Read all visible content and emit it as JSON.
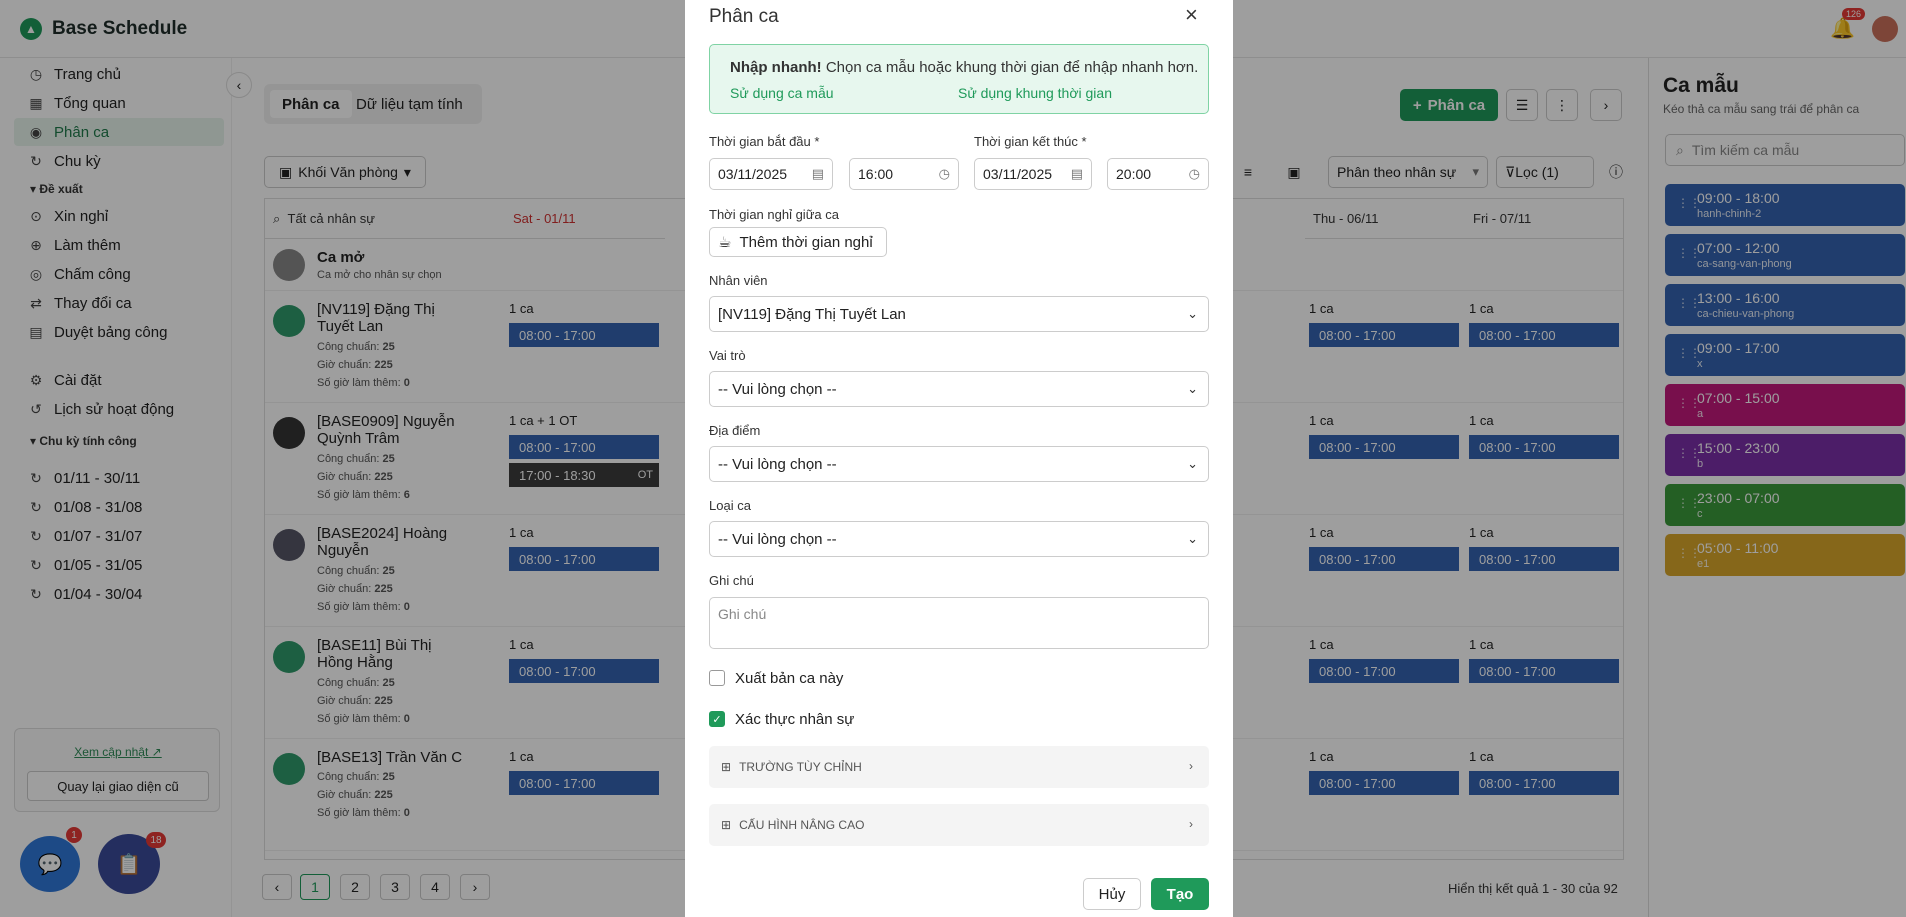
{
  "app": {
    "title": "Base Schedule",
    "notif_count": "126"
  },
  "sidebar": {
    "items": [
      {
        "label": "Trang chủ",
        "icon": "clock-icon"
      },
      {
        "label": "Tổng quan",
        "icon": "grid-icon"
      },
      {
        "label": "Phân ca",
        "icon": "shift-icon"
      },
      {
        "label": "Chu kỳ",
        "icon": "cycle-icon"
      }
    ],
    "section_propose": "Đề xuất",
    "propose_items": [
      {
        "label": "Xin nghỉ"
      },
      {
        "label": "Làm thêm"
      },
      {
        "label": "Chấm công"
      },
      {
        "label": "Thay đổi ca"
      },
      {
        "label": "Duyệt bảng công"
      }
    ],
    "settings_items": [
      {
        "label": "Cài đặt"
      },
      {
        "label": "Lịch sử hoạt động"
      }
    ],
    "section_cycles": "Chu kỳ tính công",
    "cycles": [
      "01/11 - 30/11",
      "01/08 - 31/08",
      "01/07 - 31/07",
      "01/05 - 31/05",
      "01/04 - 30/04"
    ],
    "update_link": "Xem cập nhật",
    "back_button": "Quay lại giao diện cũ",
    "fab1_badge": "1",
    "fab2_badge": "18"
  },
  "main": {
    "tabs": [
      "Phân ca",
      "Dữ liệu tạm tính"
    ],
    "add_button": "Phân ca",
    "office_filter": "Khối Văn phòng",
    "group_by": "Phân theo nhân sự",
    "filter_label": "Lọc (1)",
    "grid_headers": {
      "all_staff": "Tất cả nhân sự",
      "sat": "Sat - 01/11",
      "thu": "Thu - 06/11",
      "fri": "Fri - 07/11"
    },
    "open_shift": {
      "title": "Ca mở",
      "subtitle": "Ca mở cho nhân sự chọn"
    },
    "employees": [
      {
        "name": "[NV119] Đặng Thị Tuyết Lan",
        "cong_label": "Công chuẩn:",
        "cong": "25",
        "gio_label": "Giờ chuẩn:",
        "gio": "225",
        "ot_label": "Số giờ làm thêm:",
        "ot": "0",
        "count": "1 ca",
        "shift": "08:00 - 17:00"
      },
      {
        "name": "[BASE0909] Nguyễn Quỳnh Trâm",
        "cong_label": "Công chuẩn:",
        "cong": "25",
        "gio_label": "Giờ chuẩn:",
        "gio": "225",
        "ot_label": "Số giờ làm thêm:",
        "ot": "6",
        "count": "1 ca + 1 OT",
        "shift": "08:00 - 17:00",
        "ot_shift": "17:00 - 18:30",
        "ot_tag": "OT"
      },
      {
        "name": "[BASE2024] Hoàng Nguyễn",
        "cong_label": "Công chuẩn:",
        "cong": "25",
        "gio_label": "Giờ chuẩn:",
        "gio": "225",
        "ot_label": "Số giờ làm thêm:",
        "ot": "0",
        "count": "1 ca",
        "shift": "08:00 - 17:00"
      },
      {
        "name": "[BASE11] Bùi Thị Hồng Hằng",
        "cong_label": "Công chuẩn:",
        "cong": "25",
        "gio_label": "Giờ chuẩn:",
        "gio": "225",
        "ot_label": "Số giờ làm thêm:",
        "ot": "0",
        "count": "1 ca",
        "shift": "08:00 - 17:00"
      },
      {
        "name": "[BASE13] Trần Văn C",
        "cong_label": "Công chuẩn:",
        "cong": "25",
        "gio_label": "Giờ chuẩn:",
        "gio": "225",
        "ot_label": "Số giờ làm thêm:",
        "ot": "0",
        "count": "1 ca",
        "shift": "08:00 - 17:00"
      }
    ],
    "pages": [
      "1",
      "2",
      "3",
      "4"
    ],
    "results": "Hiển thị kết quả 1 - 30 của 92"
  },
  "templates_panel": {
    "title": "Ca mẫu",
    "subtitle": "Kéo thả ca mẫu sang trái để phân ca",
    "search_placeholder": "Tìm kiếm ca mẫu",
    "items": [
      {
        "time": "09:00 - 18:00",
        "code": "hanh-chinh-2",
        "color": "#3463b0"
      },
      {
        "time": "07:00 - 12:00",
        "code": "ca-sang-van-phong",
        "color": "#3463b0"
      },
      {
        "time": "13:00 - 16:00",
        "code": "ca-chieu-van-phong",
        "color": "#3463b0"
      },
      {
        "time": "09:00 - 17:00",
        "code": "x",
        "color": "#3463b0"
      },
      {
        "time": "07:00 - 15:00",
        "code": "a",
        "color": "#c2187a"
      },
      {
        "time": "15:00 - 23:00",
        "code": "b",
        "color": "#7b2fa8"
      },
      {
        "time": "23:00 - 07:00",
        "code": "c",
        "color": "#3a9a3a"
      },
      {
        "time": "05:00 - 11:00",
        "code": "e1",
        "color": "#d8a62a"
      }
    ]
  },
  "modal": {
    "title": "Phân ca",
    "quick_bold": "Nhập nhanh!",
    "quick_text": " Chọn ca mẫu hoặc khung thời gian để nhập nhanh hơn.",
    "use_template": "Sử dụng ca mẫu",
    "use_timeframe": "Sử dụng khung thời gian",
    "start_label": "Thời gian bắt đầu *",
    "end_label": "Thời gian kết thúc *",
    "start_date": "03/11/2025",
    "start_time": "16:00",
    "end_date": "03/11/2025",
    "end_time": "20:00",
    "break_label": "Thời gian nghỉ giữa ca",
    "break_button": "Thêm thời gian nghỉ",
    "employee_label": "Nhân viên",
    "employee_value": "[NV119] Đặng Thị Tuyết Lan",
    "role_label": "Vai trò",
    "role_value": "-- Vui lòng chọn --",
    "location_label": "Địa điểm",
    "location_value": "-- Vui lòng chọn --",
    "shift_type_label": "Loại ca",
    "shift_type_value": "-- Vui lòng chọn --",
    "note_label": "Ghi chú",
    "note_placeholder": "Ghi chú",
    "publish_label": "Xuất bản ca này",
    "verify_label": "Xác thực nhân sự",
    "custom_fields": "TRƯỜNG TÙY CHỈNH",
    "advanced": "CẤU HÌNH NÂNG CAO",
    "cancel": "Hủy",
    "create": "Tạo"
  }
}
